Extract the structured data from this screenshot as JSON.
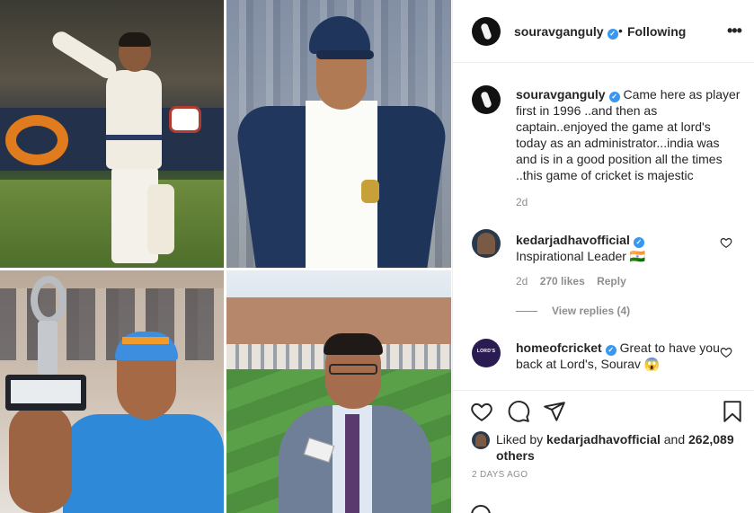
{
  "header": {
    "username": "souravganguly",
    "dot": "•",
    "follow_status": "Following",
    "more": "•••"
  },
  "caption": {
    "username": "souravganguly",
    "text": "Came here as player first in 1996 ..and then as captain..enjoyed the game at lord's today as an administrator...india was and is in a good position all the times ..this game of cricket is majestic",
    "time": "2d"
  },
  "comments": [
    {
      "username": "kedarjadhavofficial",
      "text": "Inspirational Leader 🇮🇳",
      "time": "2d",
      "likes": "270 likes",
      "reply": "Reply",
      "view_replies": "View replies (4)"
    },
    {
      "username": "homeofcricket",
      "text": "Great to have you back at Lord's, Sourav 😱",
      "avatar_text": "LORD'S"
    }
  ],
  "likes": {
    "prefix": "Liked by",
    "user": "kedarjadhavofficial",
    "and": "and",
    "others": "262,089 others"
  },
  "post_date": "2 DAYS AGO",
  "colors": {
    "verified": "#3897f0",
    "muted": "#8e8e8e",
    "text": "#262626"
  }
}
